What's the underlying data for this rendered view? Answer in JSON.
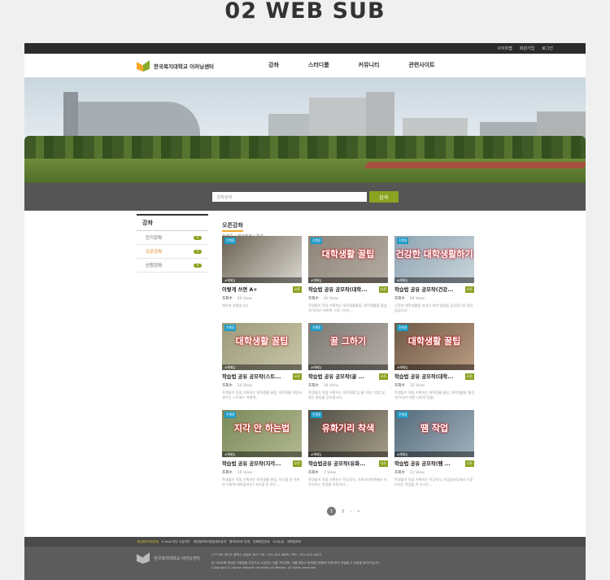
{
  "page_title": "02 WEB SUB",
  "topbar": {
    "links": [
      "사이트맵",
      "회원가입",
      "로그인"
    ]
  },
  "header": {
    "logo_text": "한국복지대학교 이러닝센터",
    "nav": [
      "강좌",
      "스터디룸",
      "커뮤니티",
      "관련사이트"
    ]
  },
  "search": {
    "placeholder": "강좌검색",
    "button": "검색"
  },
  "sidebar": {
    "title": "강좌",
    "items": [
      {
        "label": "인기강좌",
        "badge": "6"
      },
      {
        "label": "오픈강좌",
        "badge": "6"
      },
      {
        "label": "신청강좌",
        "badge": "6"
      }
    ]
  },
  "content": {
    "title": "오픈강좌",
    "subtitle": "진행중 | 개강예정 | 종료"
  },
  "cards": [
    {
      "status": "진행중",
      "thumb_text": "",
      "tag": "#체제능",
      "title": "이렇게 쓰면 A+",
      "badge": "오픈",
      "views_label": "조회수",
      "views": "40 View",
      "desc": "레카지 설명입니다",
      "colors": [
        "#6b6253",
        "#d9d6cf"
      ]
    },
    {
      "status": "진행중",
      "thumb_text": "대학생활 꿀팁",
      "tag": "#체제능",
      "title": "학습법 공유 공모작(대학...",
      "badge": "오픈",
      "views_label": "조회수",
      "views": "40 View",
      "desc": "학생들이 직접 기획하는 대학생활꿀팁, 대학생활을 즐겁게 보내기 위하여 그림 그리는...",
      "colors": [
        "#8e857a",
        "#b3aba2"
      ]
    },
    {
      "status": "진행중",
      "thumb_text": "건강한 대학생활하기",
      "tag": "#체제능",
      "title": "학습법 공유 공모작(건강...",
      "badge": "오픈",
      "views_label": "조회수",
      "views": "58 View",
      "desc": "건강한 대학생활을 보내기 위한 방법을 공유합니다 좋은팁입니다.",
      "colors": [
        "#8ea4b2",
        "#c9d4da"
      ]
    },
    {
      "status": "진행중",
      "thumb_text": "대학생활 꿀팁",
      "tag": "#체제능",
      "title": "학습법 공유 공모작(스트...",
      "badge": "오픈",
      "views_label": "조회수",
      "views": "24 View",
      "desc": "학생들이 직접 기획하는 대학생활 꿀팁, 대학생활 하면서 생기는 스트레스 어떻게...",
      "colors": [
        "#9c9a7a",
        "#c8c5a8"
      ]
    },
    {
      "status": "진행중",
      "thumb_text": "꿀 그하기",
      "tag": "#체제능",
      "title": "학습법 공유 공모작(꿀 ...",
      "badge": "오픈",
      "views_label": "조회수",
      "views": "19 View",
      "desc": "학생들이 직접 기획하는 대학생활 팁,꿀그하는 방법 및 좋은 꿀팁을 공유합니다.",
      "colors": [
        "#7d7a74",
        "#b1aca4"
      ]
    },
    {
      "status": "진행중",
      "thumb_text": "대학생활 꿀팁",
      "tag": "#체제능",
      "title": "학습법 공유 공모작(대학...",
      "badge": "오픈",
      "views_label": "조회수",
      "views": "15 View",
      "desc": "학생들이 직접 기획하는 대학생활 꿀팁, 대학생활을 즐겁게 보내기 위한 나만의 법을...",
      "colors": [
        "#6e5a48",
        "#b89a80"
      ]
    },
    {
      "status": "진행중",
      "thumb_text": "지각 안 하는법",
      "tag": "#체제능",
      "title": "학습법 공유 공모작(지각...",
      "badge": "오픈",
      "views_label": "조회수",
      "views": "16 View",
      "desc": "학생들이 직접 기획하는 대학생활 꿀팁, 지각을 안 하려면 어떻게 해야할까요? 지각을 안 하는...",
      "colors": [
        "#7a8a5a",
        "#b2b88f"
      ]
    },
    {
      "status": "진행중",
      "thumb_text": "유화기리 착색",
      "tag": "#체제능",
      "title": "학습법공유 공모작(유화...",
      "badge": "오픈",
      "views_label": "조회수",
      "views": "7 View",
      "desc": "학생들이 직접 기획하는 전공지식, 유화기리착색에서 이루어지는 작업을 유화기리...",
      "colors": [
        "#4f4d44",
        "#a39b86"
      ]
    },
    {
      "status": "진행중",
      "thumb_text": "땜 작업",
      "tag": "#체제능",
      "title": "학습법 공유 공모작(땜 ...",
      "badge": "오픈",
      "views_label": "조회수",
      "views": "11 View",
      "desc": "학생들이 직접 기획하는 전공지식, 유공솜씨업에서 이루어지는 작업을 손 보시는...",
      "colors": [
        "#556b7a",
        "#9fb0bb"
      ]
    }
  ],
  "pagination": {
    "current": "1",
    "pages": [
      "2"
    ],
    "next": "›",
    "last": "»"
  },
  "footer": {
    "links": [
      "개인정보처리방침",
      "E-mail 무단 수집거부",
      "개인정보처리방침세부공지",
      "원격사이트 안내",
      "전화번호안내",
      "오시는길",
      "대학업자메"
    ],
    "logo_text": "한국복지대학교 이러닝센터",
    "address": "(17738) 경기도 평택시 삼남로 283 | Tel : 031-610-4680 | 팩스 : 031-610-4623",
    "notice": "본 사이트에 게시된 이메일을 무단으로 수집하는 것을 거부하며, 이를 위반시 정보통신망법에 의해 형사 처벌될 수 있음을 알려드립니다.",
    "copyright": "Copyright (C) Korea national university of Welfare. All rights reserved."
  }
}
